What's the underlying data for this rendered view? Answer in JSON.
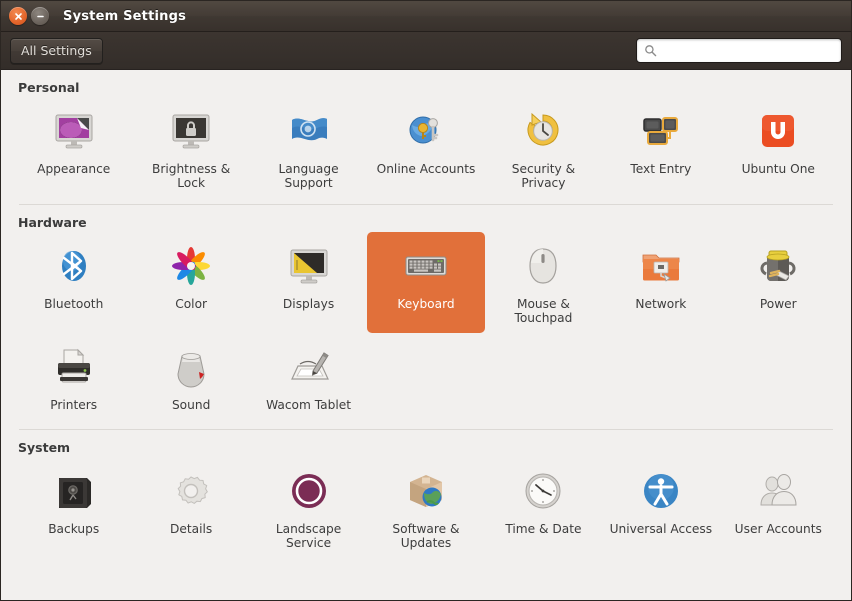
{
  "window": {
    "title": "System Settings",
    "buttons": {
      "close": "close-button",
      "minimize": "minimize-button"
    }
  },
  "toolbar": {
    "all_settings_label": "All Settings",
    "search_placeholder": "",
    "search_value": "",
    "search_icon": "search-icon"
  },
  "colors": {
    "selection": "#e1703a",
    "titlebar": "#3f3832",
    "content_bg": "#f2f0ee",
    "label": "#3d3d3d",
    "divider": "#dcd9d5"
  },
  "sections": [
    {
      "id": "personal",
      "heading": "Personal",
      "items": [
        {
          "label": "Appearance",
          "icon": "appearance-icon",
          "selected": false
        },
        {
          "label": "Brightness & Lock",
          "icon": "brightness-lock-icon",
          "selected": false
        },
        {
          "label": "Language Support",
          "icon": "language-support-icon",
          "selected": false
        },
        {
          "label": "Online Accounts",
          "icon": "online-accounts-icon",
          "selected": false
        },
        {
          "label": "Security & Privacy",
          "icon": "security-privacy-icon",
          "selected": false
        },
        {
          "label": "Text Entry",
          "icon": "text-entry-icon",
          "selected": false
        },
        {
          "label": "Ubuntu One",
          "icon": "ubuntu-one-icon",
          "selected": false
        }
      ]
    },
    {
      "id": "hardware",
      "heading": "Hardware",
      "items": [
        {
          "label": "Bluetooth",
          "icon": "bluetooth-icon",
          "selected": false
        },
        {
          "label": "Color",
          "icon": "color-icon",
          "selected": false
        },
        {
          "label": "Displays",
          "icon": "displays-icon",
          "selected": false
        },
        {
          "label": "Keyboard",
          "icon": "keyboard-icon",
          "selected": true
        },
        {
          "label": "Mouse & Touchpad",
          "icon": "mouse-touchpad-icon",
          "selected": false
        },
        {
          "label": "Network",
          "icon": "network-icon",
          "selected": false
        },
        {
          "label": "Power",
          "icon": "power-icon",
          "selected": false
        },
        {
          "label": "Printers",
          "icon": "printers-icon",
          "selected": false
        },
        {
          "label": "Sound",
          "icon": "sound-icon",
          "selected": false
        },
        {
          "label": "Wacom Tablet",
          "icon": "wacom-tablet-icon",
          "selected": false
        }
      ]
    },
    {
      "id": "system",
      "heading": "System",
      "items": [
        {
          "label": "Backups",
          "icon": "backups-icon",
          "selected": false
        },
        {
          "label": "Details",
          "icon": "details-icon",
          "selected": false
        },
        {
          "label": "Landscape Service",
          "icon": "landscape-service-icon",
          "selected": false
        },
        {
          "label": "Software & Updates",
          "icon": "software-updates-icon",
          "selected": false
        },
        {
          "label": "Time & Date",
          "icon": "time-date-icon",
          "selected": false
        },
        {
          "label": "Universal Access",
          "icon": "universal-access-icon",
          "selected": false
        },
        {
          "label": "User Accounts",
          "icon": "user-accounts-icon",
          "selected": false
        }
      ]
    }
  ]
}
